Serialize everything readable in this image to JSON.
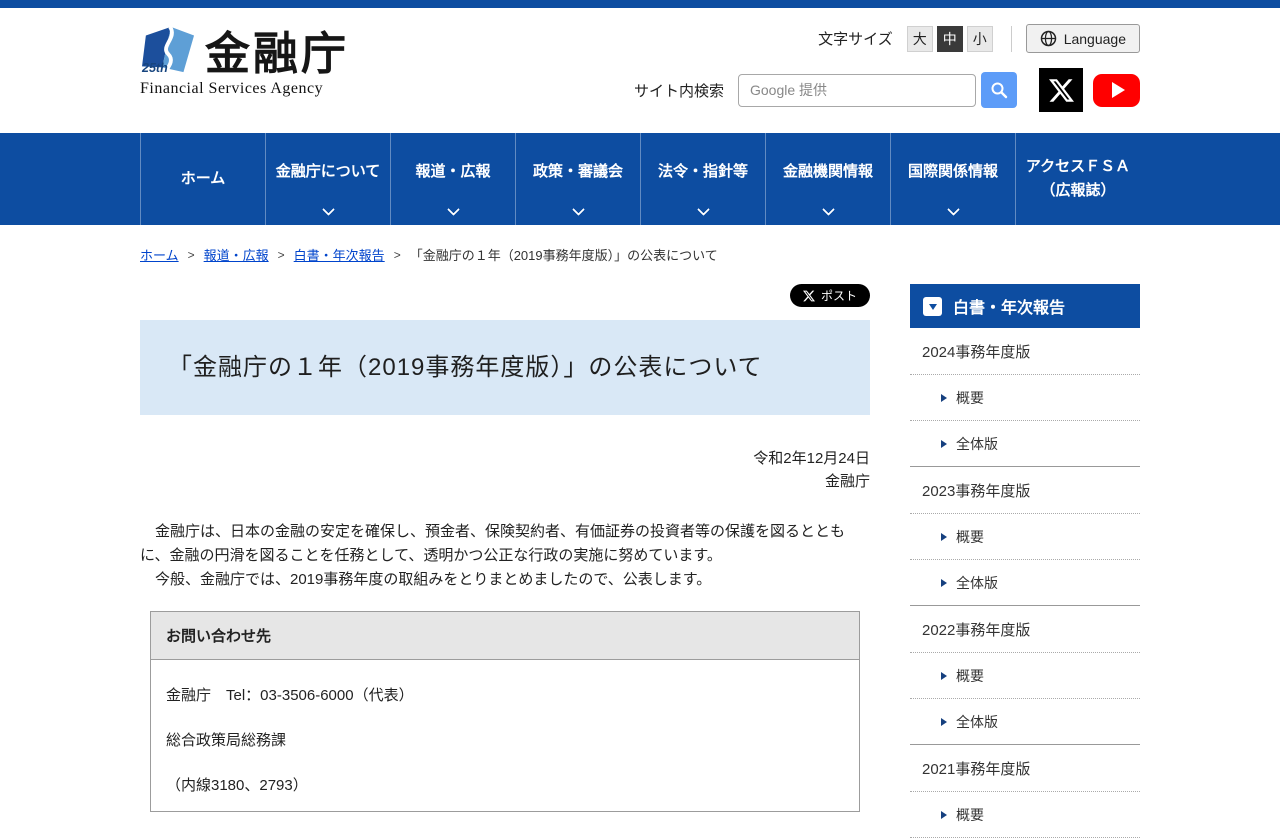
{
  "header": {
    "logo": {
      "kanji": "金融庁",
      "english": "Financial Services Agency",
      "mark": "25th"
    },
    "text_size": {
      "label": "文字サイズ",
      "options": [
        {
          "label": "大",
          "selected": false
        },
        {
          "label": "中",
          "selected": true
        },
        {
          "label": "小",
          "selected": false
        }
      ]
    },
    "language_button": {
      "label": "Language",
      "icon": "globe-icon"
    },
    "search": {
      "label": "サイト内検索",
      "placeholder": "Google 提供",
      "value": "",
      "button_icon": "magnifier-icon"
    },
    "social": [
      {
        "name": "X",
        "icon": "x-logo-icon"
      },
      {
        "name": "YouTube",
        "icon": "youtube-play-icon"
      }
    ]
  },
  "nav": {
    "items": [
      {
        "label": "ホーム",
        "has_chevron": false
      },
      {
        "label": "金融庁について",
        "has_chevron": true
      },
      {
        "label": "報道・広報",
        "has_chevron": true
      },
      {
        "label": "政策・審議会",
        "has_chevron": true
      },
      {
        "label": "法令・指針等",
        "has_chevron": true
      },
      {
        "label": "金融機関情報",
        "has_chevron": true
      },
      {
        "label": "国際関係情報",
        "has_chevron": true
      },
      {
        "label": "アクセスＦＳＡ",
        "label2": "（広報誌）",
        "has_chevron": false
      }
    ]
  },
  "breadcrumb": {
    "separator": ">",
    "items": [
      {
        "label": "ホーム",
        "link": true
      },
      {
        "label": "報道・広報",
        "link": true
      },
      {
        "label": "白書・年次報告",
        "link": true
      },
      {
        "label": "「金融庁の１年（2019事務年度版）」の公表について",
        "link": false
      }
    ]
  },
  "main": {
    "post_button": {
      "label": "ポスト",
      "icon": "x-logo-icon"
    },
    "page_title": "「金融庁の１年（2019事務年度版）」の公表について",
    "date_line": "令和2年12月24日",
    "org_line": "金融庁",
    "paragraphs": [
      "　金融庁は、日本の金融の安定を確保し、預金者、保険契約者、有価証券の投資者等の保護を図るとともに、金融の円滑を図ることを任務として、透明かつ公正な行政の実施に努めています。",
      "　今般、金融庁では、2019事務年度の取組みをとりまとめましたので、公表します。"
    ],
    "contact": {
      "title": "お問い合わせ先",
      "lines": [
        "金融庁　Tel：03-3506-6000（代表）",
        "総合政策局総務課",
        "（内線3180、2793）"
      ]
    }
  },
  "sidebar": {
    "title": "白書・年次報告",
    "items": [
      {
        "label": "2024事務年度版",
        "level": 1,
        "divider": "dotted"
      },
      {
        "label": "概要",
        "level": 2,
        "divider": "dotted"
      },
      {
        "label": "全体版",
        "level": 2,
        "divider": "solid"
      },
      {
        "label": "2023事務年度版",
        "level": 1,
        "divider": "dotted"
      },
      {
        "label": "概要",
        "level": 2,
        "divider": "dotted"
      },
      {
        "label": "全体版",
        "level": 2,
        "divider": "solid"
      },
      {
        "label": "2022事務年度版",
        "level": 1,
        "divider": "dotted"
      },
      {
        "label": "概要",
        "level": 2,
        "divider": "dotted"
      },
      {
        "label": "全体版",
        "level": 2,
        "divider": "solid"
      },
      {
        "label": "2021事務年度版",
        "level": 1,
        "divider": "dotted"
      },
      {
        "label": "概要",
        "level": 2,
        "divider": "dotted"
      }
    ]
  },
  "colors": {
    "nav_blue": "#0d4da1",
    "title_box_blue": "#d9e8f6",
    "search_button_blue": "#5d9cf8",
    "youtube_red": "#ff0000",
    "post_button_black": "#000000",
    "selected_text_size_bg": "#3a3a3a"
  }
}
